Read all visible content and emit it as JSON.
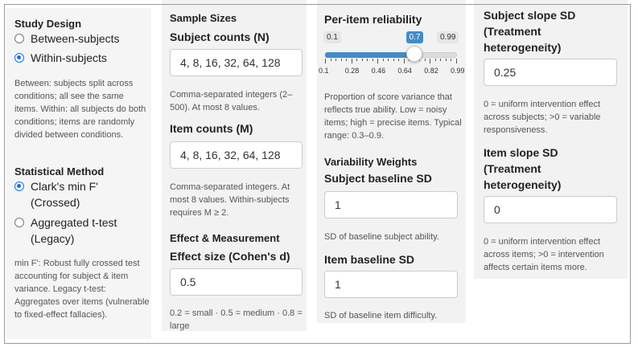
{
  "study_design": {
    "title": "Study Design",
    "options": [
      {
        "label": "Between-subjects",
        "checked": false
      },
      {
        "label": "Within-subjects",
        "checked": true
      }
    ],
    "help": "Between: subjects split across conditions; all see the same items. Within: all subjects do both conditions; items are randomly divided between conditions."
  },
  "statistical_method": {
    "title": "Statistical Method",
    "options": [
      {
        "line1": "Clark's min F'",
        "line2": "(Crossed)",
        "checked": true
      },
      {
        "line1": "Aggregated t-test",
        "line2": "(Legacy)",
        "checked": false
      }
    ],
    "help": "min F': Robust fully crossed test accounting for subject & item variance. Legacy t-test: Aggregates over items (vulnerable to fixed-effect fallacies)."
  },
  "sample_sizes": {
    "title": "Sample Sizes",
    "subject_counts": {
      "label": "Subject counts (N)",
      "value": "4, 8, 16, 32, 64, 128",
      "help": "Comma-separated integers (2–500). At most 8 values."
    },
    "item_counts": {
      "label": "Item counts (M)",
      "value": "4, 8, 16, 32, 64, 128",
      "help": "Comma-separated integers. At most 8 values. Within-subjects requires M ≥ 2."
    }
  },
  "effect_measurement": {
    "title": "Effect & Measurement",
    "effect_size": {
      "label": "Effect size (Cohen's d)",
      "value": "0.5",
      "help": "0.2 = small · 0.5 = medium · 0.8 = large"
    }
  },
  "reliability": {
    "label": "Per-item reliability",
    "min": 0.1,
    "max": 0.99,
    "value": 0.7,
    "min_label": "0.1",
    "max_label": "0.99",
    "value_label": "0.7",
    "ticks": [
      "0.1",
      "0.28",
      "0.46",
      "0.64",
      "0.82",
      "0.99"
    ],
    "help": "Proportion of score variance that reflects true ability. Low = noisy items; high = precise items. Typical range: 0.3–0.9."
  },
  "variability": {
    "title": "Variability Weights",
    "subject_baseline": {
      "label": "Subject baseline SD",
      "value": "1",
      "help": "SD of baseline subject ability."
    },
    "item_baseline": {
      "label": "Item baseline SD",
      "value": "1",
      "help": "SD of baseline item difficulty."
    }
  },
  "treatment": {
    "subject_slope": {
      "label": "Subject slope SD (Treatment heterogeneity)",
      "value": "0.25",
      "help": "0 = uniform intervention effect across subjects; >0 = variable responsiveness."
    },
    "item_slope": {
      "label": "Item slope SD (Treatment heterogeneity)",
      "value": "0",
      "help": "0 = uniform intervention effect across items; >0 = intervention affects certain items more."
    }
  },
  "colors": {
    "accent": "#0d6efd",
    "slider_fill": "#428bca",
    "panel_bg": "#f2f2f2"
  }
}
